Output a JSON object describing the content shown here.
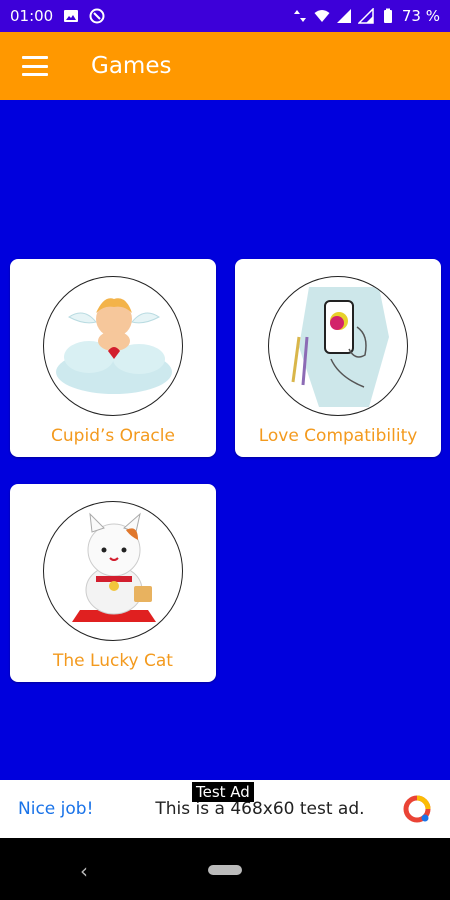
{
  "status_bar": {
    "time": "01:00",
    "battery": "73 %"
  },
  "app_bar": {
    "title": "Games"
  },
  "games": [
    {
      "label": "Cupid’s Oracle"
    },
    {
      "label": "Love Compatibility"
    },
    {
      "label": "The Lucky Cat"
    }
  ],
  "ad": {
    "tag": "Test Ad",
    "left_text": "Nice job!",
    "middle_text": "This is a 468x60 test ad."
  },
  "colors": {
    "status_bar": "#3d00d9",
    "app_bar": "#ff9800",
    "content_bg": "#0000dd",
    "card_label": "#f39a1e"
  }
}
